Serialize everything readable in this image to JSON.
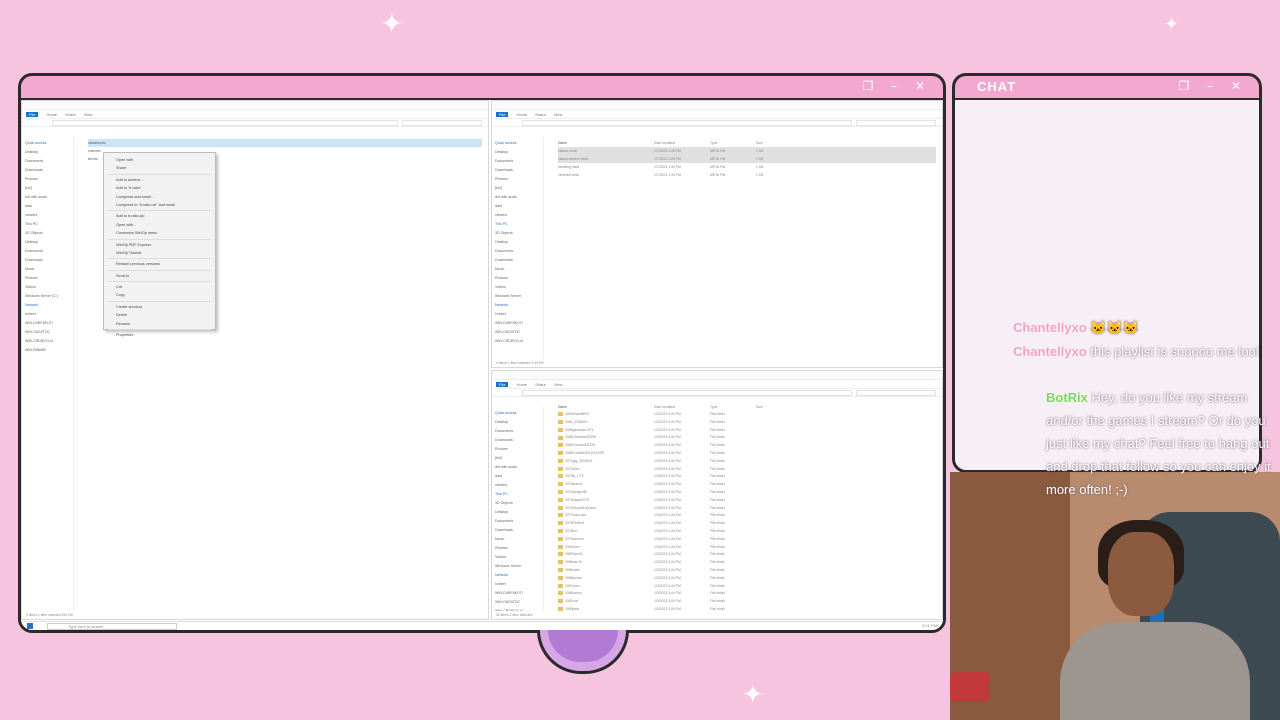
{
  "screen_frame": {
    "controls": [
      "❐",
      "–",
      "✕"
    ]
  },
  "chat_frame": {
    "title": "CHAT",
    "controls": [
      "❐",
      "–",
      "✕"
    ],
    "messages": [
      {
        "user": "Chantellyxo",
        "text": "🐱🐱🐱",
        "color": "#f2a0c8"
      },
      {
        "user": "Chantellyxo",
        "text": "this playlist is sooooo me lool",
        "color": "#f2a0c8"
      },
      {
        "user": "BotRix",
        "text": "Hey, do you like my stream and/or the games I stream? Or do you just like my chat? Feel free to hang out and drop that follow so you can enjoy it more often! ;-)",
        "color": "#7ed957"
      }
    ]
  },
  "explorer_left": {
    "ribbon": [
      "File",
      "Home",
      "Share",
      "View"
    ],
    "nav": [
      "Quick access",
      "Desktop",
      "Documents",
      "Downloads",
      "Pictures",
      "[full]",
      "dirt with audio",
      "data",
      "viewers",
      "This PC",
      "3D Objects",
      "Desktop",
      "Documents",
      "Downloads",
      "Music",
      "Pictures",
      "Videos",
      "Windows Server (C:)",
      "Network",
      "hvbeet",
      "WIN-D4RF8KUTI",
      "WIN-O6G9TDC",
      "WIN-CRDBVCU4",
      "WIN-R8NMB"
    ],
    "files": [
      "viewers.mtc",
      "cmd.mtc",
      "tsr.mtc"
    ],
    "status": "3 items    1 item selected  514 KB"
  },
  "context_menu": {
    "items": [
      "Open with",
      "Share",
      "",
      "Add to archive...",
      "Add to \"tr.ratio\"",
      "Compress and email...",
      "Compress to \"tr.ratio.rar\" and email",
      "",
      "Add to tr.ratio.zip",
      "Open with...",
      "Customize WinZip menu",
      "",
      "WinZip PDF Express",
      "WinZip Tutorial",
      "",
      "Restore previous versions",
      "",
      "Send to",
      "",
      "Cut",
      "Copy",
      "",
      "Create shortcut",
      "Delete",
      "Rename",
      "",
      "Properties"
    ]
  },
  "explorer_right_top": {
    "ribbon": [
      "File",
      "Home",
      "Share",
      "View"
    ],
    "nav": [
      "Quick access",
      "Desktop",
      "Documents",
      "Downloads",
      "Pictures",
      "[full]",
      "dirt with audio",
      "data",
      "viewers",
      "This PC",
      "3D Objects",
      "Desktop",
      "Documents",
      "Downloads",
      "Music",
      "Pictures",
      "Videos",
      "Windows Server",
      "Network",
      "hvbeet",
      "WIN-D4RF8KUTI",
      "WIN-O6G9TDC",
      "WIN-CRDBVCU4"
    ],
    "columns": [
      "Name",
      "Date modified",
      "Type",
      "Size"
    ],
    "files": [
      [
        "classic.meta",
        "1/7/2023 1:26 PM",
        "META File",
        "1 KB"
      ],
      [
        "classicviewers.meta",
        "1/7/2023 1:26 PM",
        "META File",
        "1 KB"
      ],
      [
        "handling.meta",
        "1/7/2023 1:34 PM",
        "META File",
        "1 KB"
      ],
      [
        "vehicles.meta",
        "1/7/2023 1:33 PM",
        "META File",
        "1 KB"
      ]
    ],
    "status": "4 items    1 item selected  1.61 KB"
  },
  "explorer_right_bottom": {
    "ribbon": [
      "File",
      "Home",
      "Share",
      "View"
    ],
    "nav": [
      "Quick access",
      "Desktop",
      "Documents",
      "Downloads",
      "Pictures",
      "[full]",
      "dirt with audio",
      "data",
      "viewers",
      "This PC",
      "3D Objects",
      "Desktop",
      "Documents",
      "Downloads",
      "Music",
      "Pictures",
      "Videos",
      "Windows Server",
      "Network",
      "hvbeet",
      "WIN-D4RF8KUTI",
      "WIN-O6G9TDC",
      "WIN-CRDBVCU4"
    ],
    "columns": [
      "Name",
      "Date modified",
      "Type",
      "Size"
    ],
    "folders": [
      "1800sSandBRC",
      "1964_ZEN60G",
      "1965gasserkc1971",
      "1966ChevelleSS396",
      "1969CamaroSSZ28",
      "1969CudaWORLDSTARS",
      "1971gtg_ZEN60G",
      "1972chev",
      "1973el_CTZ",
      "1973mach1",
      "1974dodgeHB",
      "1974BassoGTR",
      "1975ScorpMcQueen",
      "1977trans-am",
      "1978Firebird",
      "1978fox",
      "1979camero",
      "1980chev",
      "1983Yacht1",
      "1984ram7k",
      "1985vette",
      "1986hunter",
      "1987chev",
      "1988carrez",
      "1989-ext",
      "1990jetta",
      "1995DELTA",
      "asiafast",
      "gtx",
      "WRX(KBZ)JYAR3TC400J"
    ],
    "folder_date": "1/3/2023 3:44 PM",
    "folder_type": "File folder",
    "status": "30 items    1 item selected"
  },
  "taskbar": {
    "search": "Type here to search",
    "clock": "3:21 PM"
  }
}
